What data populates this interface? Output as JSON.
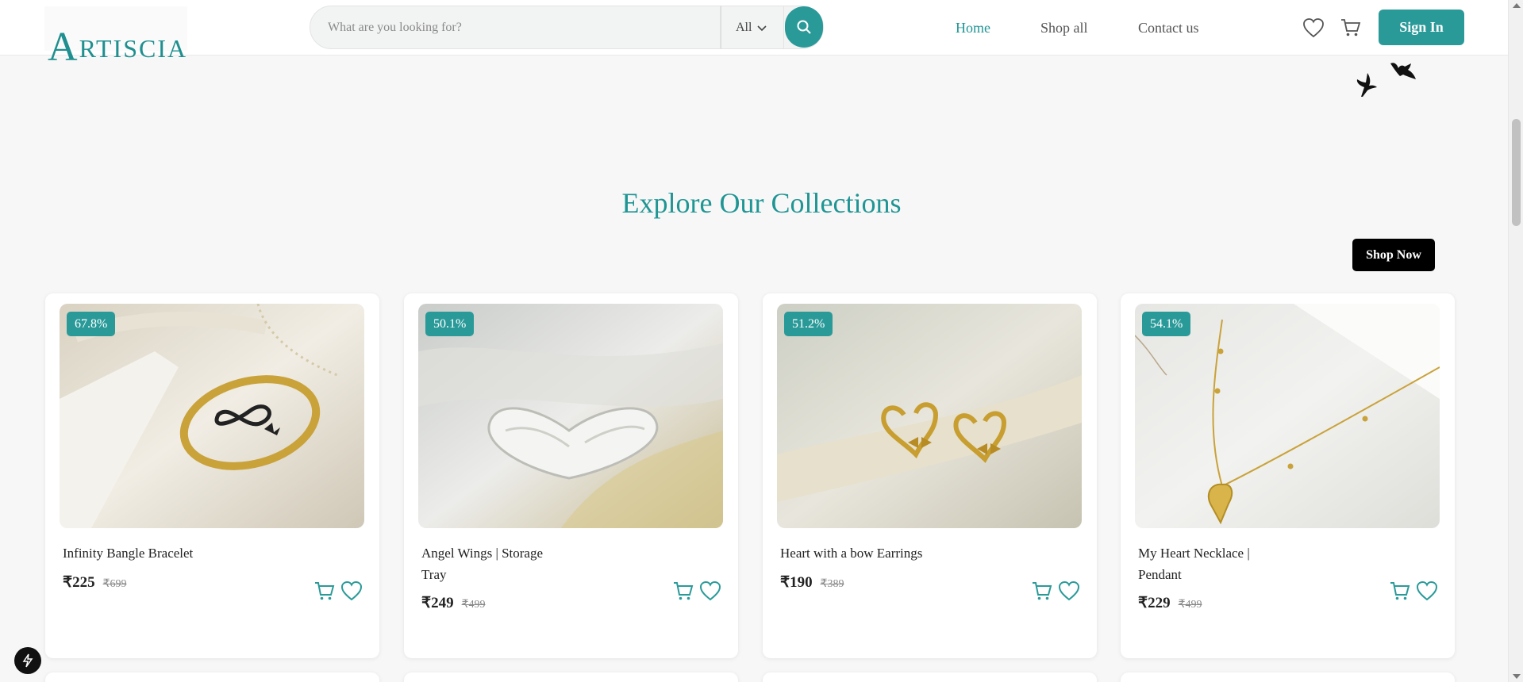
{
  "header": {
    "logo_text": "ARTISCIA",
    "logo_initial": "A",
    "logo_rest": "RTISCIA",
    "search": {
      "placeholder": "What are you looking for?",
      "category": "All"
    },
    "nav": [
      {
        "label": "Home",
        "active": true
      },
      {
        "label": "Shop all",
        "active": false
      },
      {
        "label": "Contact us",
        "active": false
      }
    ],
    "icons": {
      "wishlist": "heart-icon",
      "cart": "cart-icon",
      "search": "search-icon"
    },
    "signin_label": "Sign In"
  },
  "section": {
    "title": "Explore Our Collections",
    "shop_now_label": "Shop Now"
  },
  "products": [
    {
      "name": "Infinity Bangle Bracelet",
      "price": "₹225",
      "old_price": "₹699",
      "discount": "67.8%"
    },
    {
      "name": "Angel Wings | Storage Tray",
      "price": "₹249",
      "old_price": "₹499",
      "discount": "50.1%"
    },
    {
      "name": "Heart with a bow Earrings",
      "price": "₹190",
      "old_price": "₹389",
      "discount": "51.2%"
    },
    {
      "name": "My Heart Necklace | Pendant",
      "price": "₹229",
      "old_price": "₹499",
      "discount": "54.1%"
    }
  ],
  "colors": {
    "accent": "#2a9a99",
    "background": "#f7f7f7",
    "shop_now": "#000000"
  }
}
